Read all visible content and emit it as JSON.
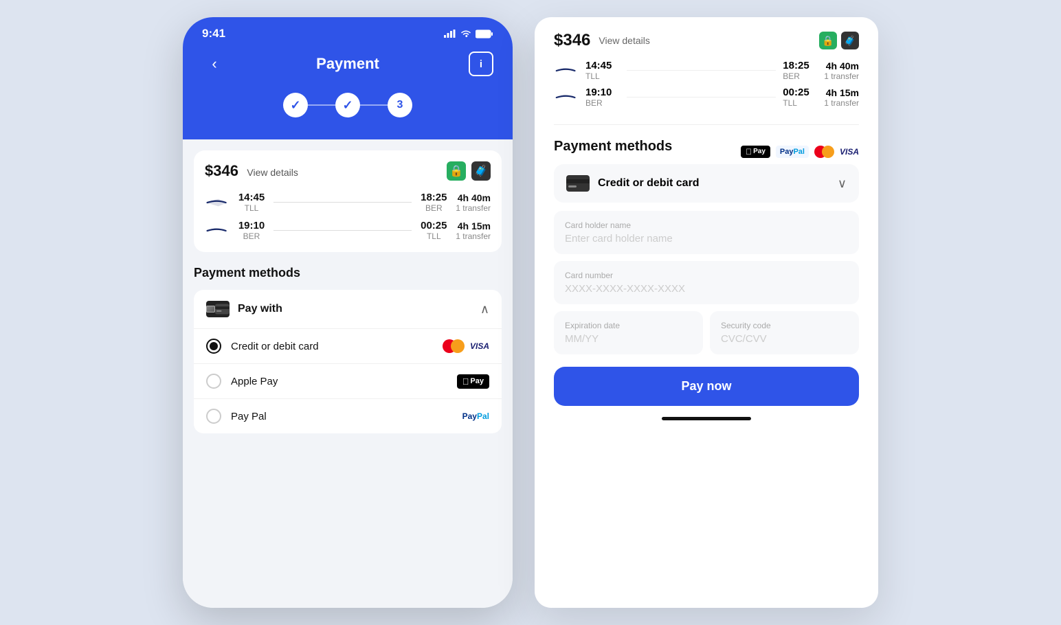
{
  "phone": {
    "status_time": "9:41",
    "nav_title": "Payment",
    "price": "$346",
    "view_details": "View details",
    "flights": [
      {
        "depart_time": "14:45",
        "depart_code": "TLL",
        "arrive_time": "18:25",
        "arrive_code": "BER",
        "duration": "4h 40m",
        "transfer": "1 transfer"
      },
      {
        "depart_time": "19:10",
        "depart_code": "BER",
        "arrive_time": "00:25",
        "arrive_code": "TLL",
        "duration": "4h 15m",
        "transfer": "1 transfer"
      }
    ],
    "payment_methods_title": "Payment methods",
    "pay_with_label": "Pay with",
    "options": [
      {
        "label": "Credit or debit card",
        "selected": true
      },
      {
        "label": "Apple Pay",
        "selected": false
      },
      {
        "label": "Pay Pal",
        "selected": false
      }
    ]
  },
  "right": {
    "price": "$346",
    "view_details": "View details",
    "flights": [
      {
        "depart_time": "14:45",
        "depart_code": "TLL",
        "arrive_time": "18:25",
        "arrive_code": "BER",
        "duration": "4h 40m",
        "transfer": "1 transfer"
      },
      {
        "depart_time": "19:10",
        "depart_code": "BER",
        "arrive_time": "00:25",
        "arrive_code": "TLL",
        "duration": "4h 15m",
        "transfer": "1 transfer"
      }
    ],
    "payment_methods_title": "Payment methods",
    "card_option_label": "Credit or debit card",
    "fields": {
      "card_holder_label": "Card holder name",
      "card_holder_placeholder": "Enter card holder name",
      "card_number_label": "Card number",
      "card_number_placeholder": "XXXX-XXXX-XXXX-XXXX",
      "expiry_label": "Expiration date",
      "expiry_placeholder": "MM/YY",
      "cvv_label": "Security code",
      "cvv_placeholder": "CVC/CVV"
    },
    "pay_now_label": "Pay now"
  }
}
